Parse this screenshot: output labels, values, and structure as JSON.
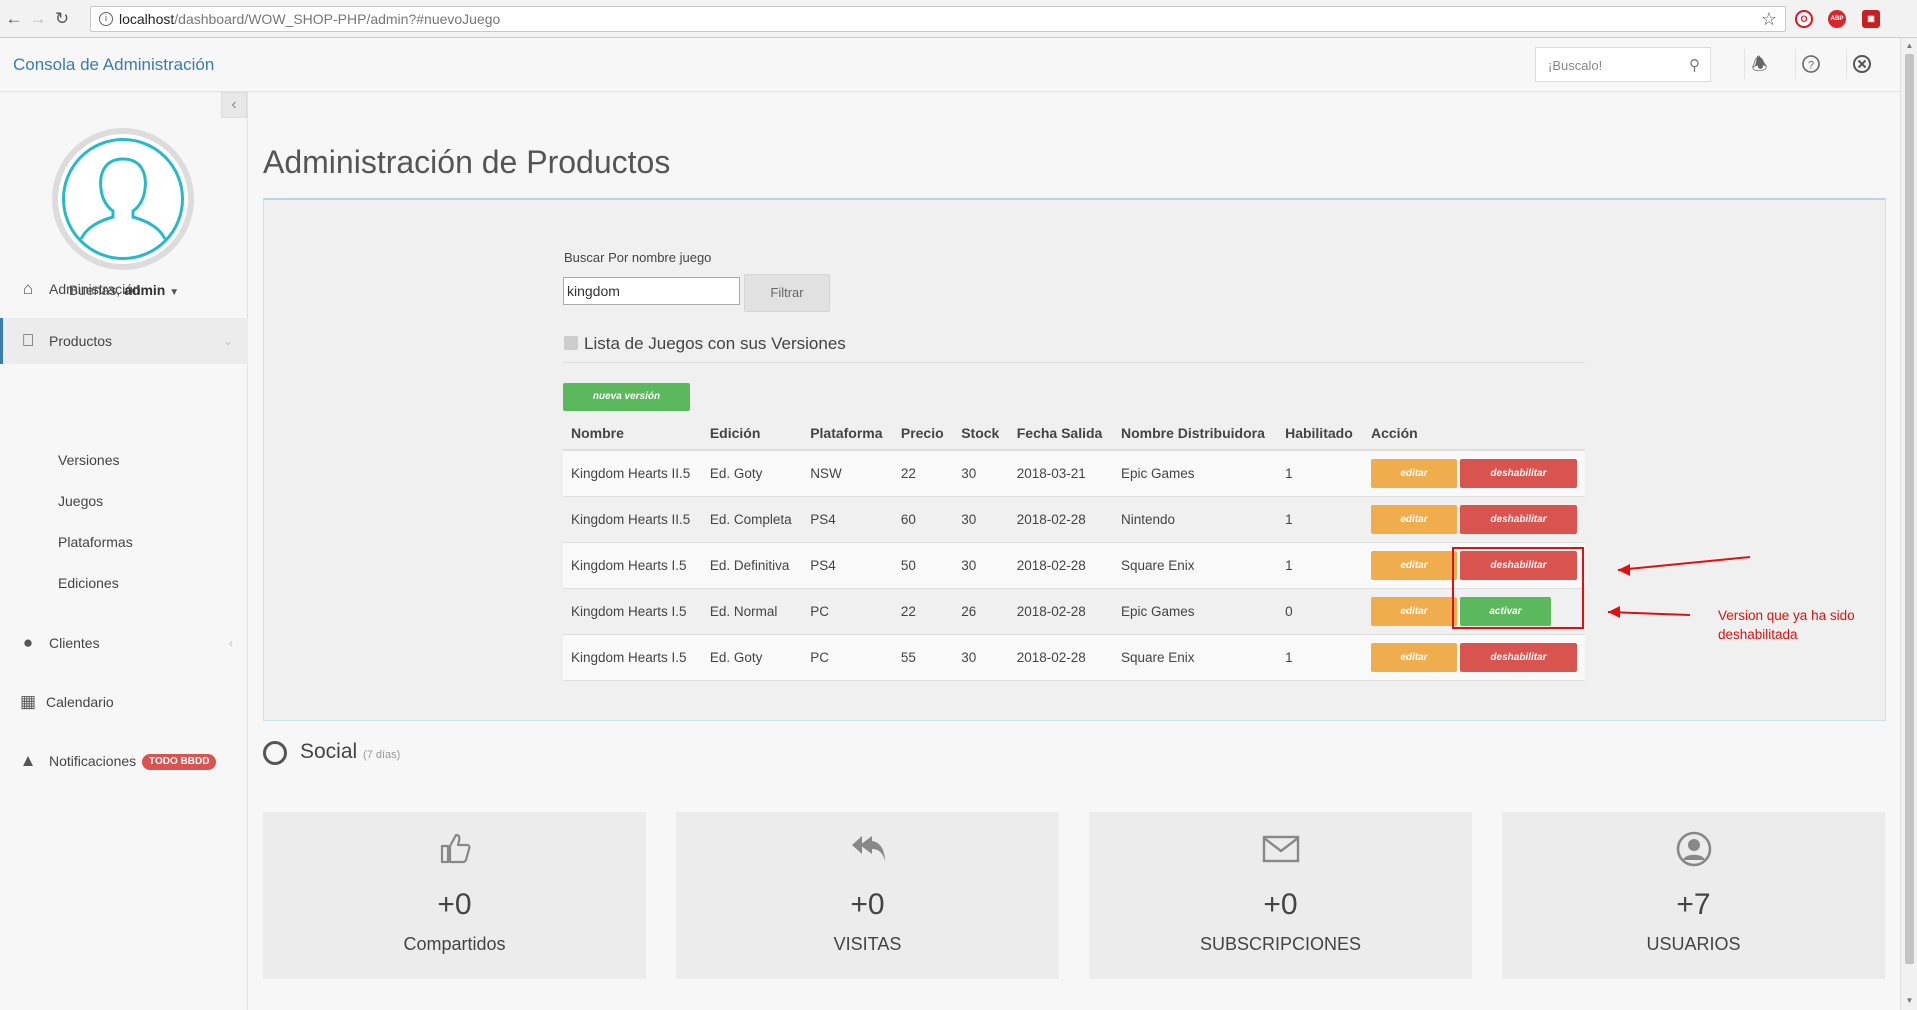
{
  "browser": {
    "url_host": "localhost",
    "url_path": "/dashboard/WOW_SHOP-PHP/admin?#nuevoJuego",
    "ext_opera": "O",
    "ext_abp": "ABP",
    "ext_red": "▣"
  },
  "header": {
    "brand": "Consola de Administración",
    "search_placeholder": "¡Buscalo!"
  },
  "sidebar": {
    "greeting_prefix": "Buenas,",
    "user": "admin",
    "items": [
      {
        "label": "Administración",
        "icon": "home-icon"
      },
      {
        "label": "Productos",
        "icon": "apple-icon"
      },
      {
        "label": "Clientes",
        "icon": "user-icon"
      },
      {
        "label": "Calendario",
        "icon": "calendar-icon"
      },
      {
        "label": "Notificaciones",
        "icon": "bell-icon",
        "badge": "TODO BBDD"
      }
    ],
    "productos_sub": [
      "Versiones",
      "Juegos",
      "Plataformas",
      "Ediciones"
    ]
  },
  "main": {
    "title": "Administración de Productos",
    "filter_label": "Buscar Por nombre juego",
    "filter_value": "kingdom",
    "filter_button": "Filtrar",
    "list_heading": "Lista de Juegos con sus Versiones",
    "new_button": "nueva versión",
    "columns": [
      "Nombre",
      "Edición",
      "Plataforma",
      "Precio",
      "Stock",
      "Fecha Salida",
      "Nombre Distribuidora",
      "Habilitado",
      "Acción"
    ],
    "rows": [
      {
        "nombre": "Kingdom Hearts II.5",
        "edicion": "Ed. Goty",
        "plataforma": "NSW",
        "precio": "22",
        "stock": "30",
        "fecha": "2018-03-21",
        "distribuidora": "Epic Games",
        "habilitado": "1",
        "edit": "editar",
        "toggle": "deshabilitar"
      },
      {
        "nombre": "Kingdom Hearts II.5",
        "edicion": "Ed. Completa",
        "plataforma": "PS4",
        "precio": "60",
        "stock": "30",
        "fecha": "2018-02-28",
        "distribuidora": "Nintendo",
        "habilitado": "1",
        "edit": "editar",
        "toggle": "deshabilitar"
      },
      {
        "nombre": "Kingdom Hearts I.5",
        "edicion": "Ed. Definitiva",
        "plataforma": "PS4",
        "precio": "50",
        "stock": "30",
        "fecha": "2018-02-28",
        "distribuidora": "Square Enix",
        "habilitado": "1",
        "edit": "editar",
        "toggle": "deshabilitar"
      },
      {
        "nombre": "Kingdom Hearts I.5",
        "edicion": "Ed. Normal",
        "plataforma": "PC",
        "precio": "22",
        "stock": "26",
        "fecha": "2018-02-28",
        "distribuidora": "Epic Games",
        "habilitado": "0",
        "edit": "editar",
        "toggle": "activar"
      },
      {
        "nombre": "Kingdom Hearts I.5",
        "edicion": "Ed. Goty",
        "plataforma": "PC",
        "precio": "55",
        "stock": "30",
        "fecha": "2018-02-28",
        "distribuidora": "Square Enix",
        "habilitado": "1",
        "edit": "editar",
        "toggle": "deshabilitar"
      }
    ],
    "annotation": "Version que ya ha sido deshabilitada"
  },
  "social": {
    "title": "Social",
    "period": "(7 días)",
    "cards": [
      {
        "icon": "thumbs-up-icon",
        "value": "+0",
        "label": "Compartidos"
      },
      {
        "icon": "reply-all-icon",
        "value": "+0",
        "label": "VISITAS"
      },
      {
        "icon": "envelope-icon",
        "value": "+0",
        "label": "SUBSCRIPCIONES"
      },
      {
        "icon": "user-circle-icon",
        "value": "+7",
        "label": "USUARIOS"
      }
    ]
  },
  "colors": {
    "brand_blue": "#3a7cb0",
    "success": "#5cb85c",
    "warning": "#f0ad4e",
    "danger": "#d9534f",
    "annotation_red": "#e01010",
    "avatar_teal": "#27b9c8"
  }
}
